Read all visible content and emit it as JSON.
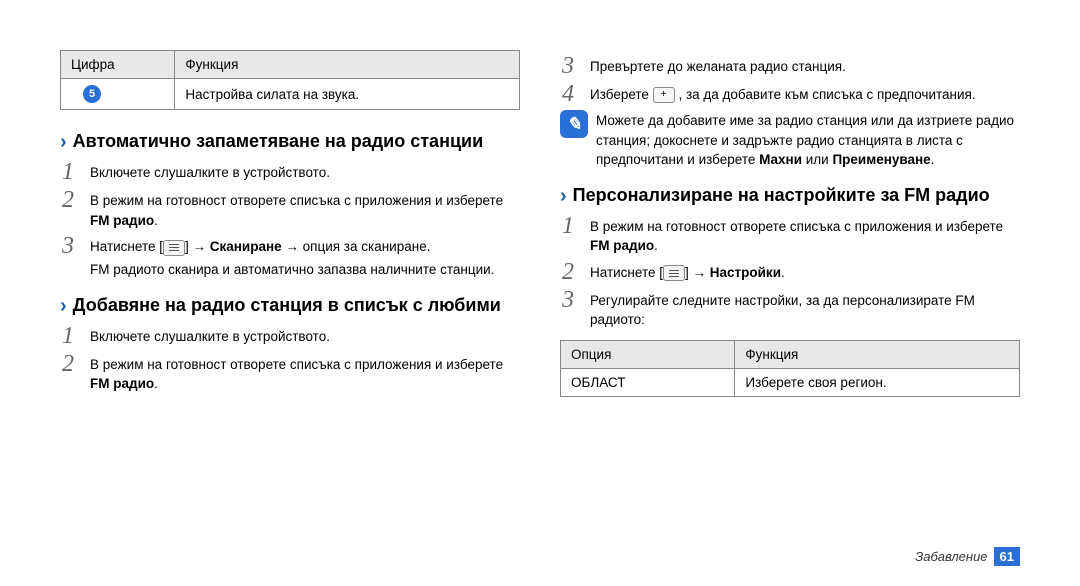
{
  "left": {
    "table1": {
      "header_num": "Цифра",
      "header_func": "Функция",
      "row_num": "5",
      "row_func": "Настройва силата на звука."
    },
    "section1": {
      "heading": "Автоматично запаметяване на радио станции",
      "step1": "Включете слушалките в устройството.",
      "step2_part1": "В режим на готовност отворете списъка с приложения и изберете ",
      "step2_bold": "FM радио",
      "step2_part2": ".",
      "step3_part1": "Натиснете [",
      "step3_part2": "] → ",
      "step3_bold": "Сканиране",
      "step3_part3": " → опция за сканиране.",
      "step3_cont": "FM радиото сканира и автоматично запазва наличните станции."
    },
    "section2": {
      "heading": "Добавяне на радио станция в списък с любими",
      "step1": "Включете слушалките в устройството.",
      "step2_part1": "В режим на готовност отворете списъка с приложения и изберете ",
      "step2_bold": "FM радио",
      "step2_part2": "."
    }
  },
  "right": {
    "step3": "Превъртете до желаната радио станция.",
    "step4_part1": "Изберете ",
    "step4_plus": "+",
    "step4_part2": " , за да добавите към списъка с предпочитания.",
    "note_part1": "Можете да добавите име за радио станция или да изтриете радио станция; докоснете и задръжте радио станцията в листа с предпочитани и изберете ",
    "note_bold1": "Махни",
    "note_mid": " или ",
    "note_bold2": "Преименуване",
    "note_end": ".",
    "section3": {
      "heading": "Персонализиране на настройките за FM радио",
      "step1_part1": "В режим на готовност отворете списъка с приложения и изберете ",
      "step1_bold": "FM радио",
      "step1_part2": ".",
      "step2_part1": "Натиснете [",
      "step2_part2": "] → ",
      "step2_bold": "Настройки",
      "step2_part3": ".",
      "step3": "Регулирайте следните настройки, за да персонализирате FM радиото:"
    },
    "table2": {
      "header_opt": "Опция",
      "header_func": "Функция",
      "row_opt": "ОБЛАСТ",
      "row_func": "Изберете своя регион."
    }
  },
  "footer": {
    "section": "Забавление",
    "page": "61"
  }
}
